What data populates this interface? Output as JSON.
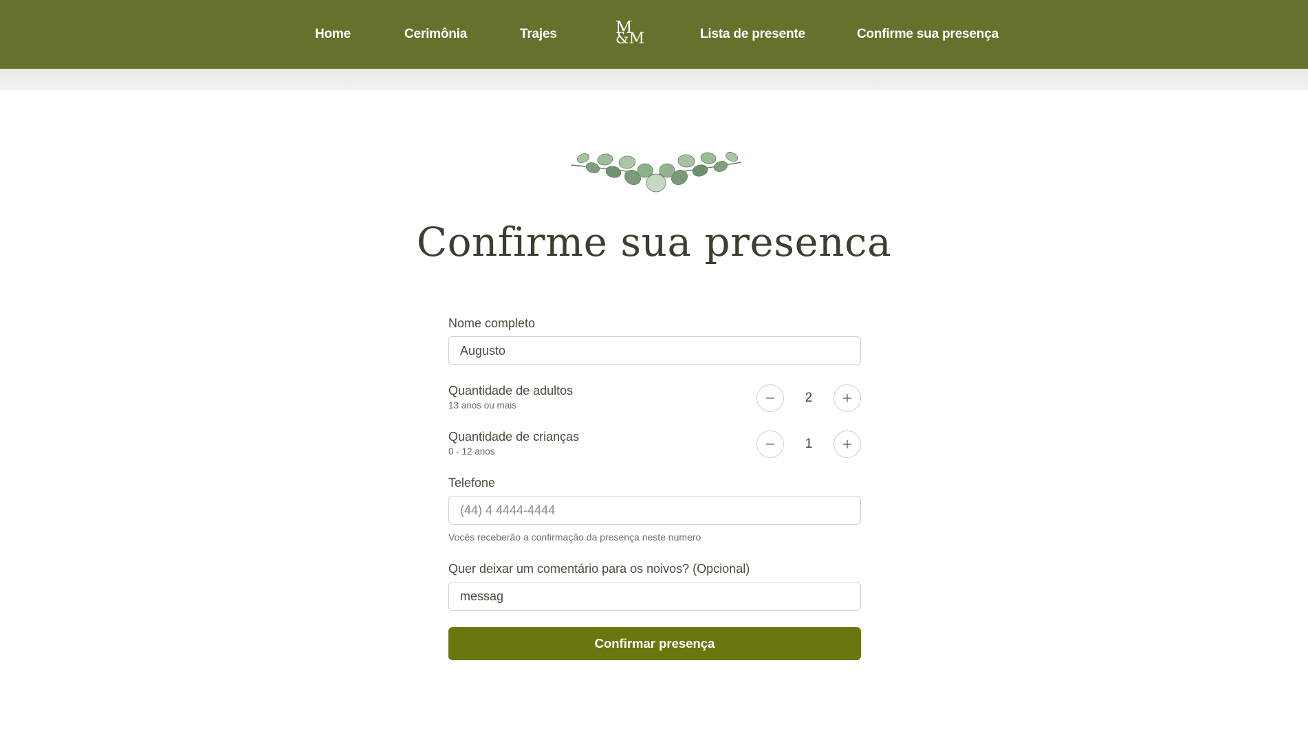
{
  "nav": {
    "items": [
      {
        "label": "Home"
      },
      {
        "label": "Cerimônia"
      },
      {
        "label": "Trajes"
      },
      {
        "label": "Lista de presente"
      },
      {
        "label": "Confirme sua presença"
      }
    ],
    "logo": {
      "line1": "M",
      "line2": "&M"
    }
  },
  "page": {
    "title": "Confirme sua presenca"
  },
  "form": {
    "name": {
      "label": "Nome completo",
      "value": "Augusto"
    },
    "adults": {
      "label": "Quantidade de adultos",
      "sublabel": "13 anos ou mais",
      "value": "2"
    },
    "children": {
      "label": "Quantidade de crianças",
      "sublabel": "0 - 12 anos",
      "value": "1"
    },
    "phone": {
      "label": "Telefone",
      "placeholder": "(44) 4 4444-4444",
      "hint": "Vocês receberão a confirmação da presença neste numero"
    },
    "comment": {
      "label": "Quer deixar um comentário para os noivos? (Opcional)",
      "value": "messag"
    },
    "submit_label": "Confirmar presença"
  },
  "colors": {
    "nav_bg": "#66712d",
    "button_bg": "#6b760f",
    "title_text": "#3c3f30"
  },
  "icons": {
    "minus": "minus-icon",
    "plus": "plus-icon",
    "ornament": "eucalyptus-leaves-icon"
  }
}
